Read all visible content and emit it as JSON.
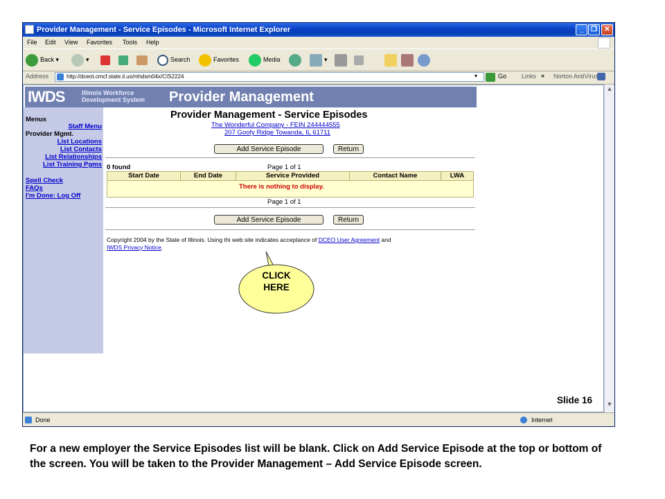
{
  "window": {
    "title": "Provider Management - Service Episodes - Microsoft Internet Explorer",
    "controls": [
      "_",
      "❐",
      "✕"
    ]
  },
  "menubar": [
    "File",
    "Edit",
    "View",
    "Favorites",
    "Tools",
    "Help"
  ],
  "toolbar": {
    "back": "Back",
    "search": "Search",
    "favorites": "Favorites",
    "media": "Media"
  },
  "address": {
    "label": "Address",
    "url": "http://dceot.cmcf.state.il.us/mhdsm04x/CIS2224",
    "go": "Go",
    "links": "Links",
    "chevron": "»",
    "norton": "Norton AntiVirus"
  },
  "header": {
    "logo": "IWDS",
    "sub_line1": "Illinois Workforce",
    "sub_line2": "Development System",
    "banner": "Provider Management"
  },
  "sidebar": {
    "menus": "Menus",
    "staff_menu": "Staff Menu",
    "provider_mgmt": "Provider Mgmt.",
    "items": [
      "List Locations",
      "List Contacts",
      "List Relationships",
      "List Training Pgms"
    ],
    "spell_check": "Spell Check",
    "faqs": "FAQs",
    "logoff": "I'm Done: Log Off"
  },
  "main": {
    "title": "Provider Management - Service Episodes",
    "company": "The Wonderful Company - FEIN 244444555",
    "address": "207 Goofy Ridge Towanda, IL 61711",
    "add_button": "Add Service Episode",
    "return_button": "Return",
    "found": "0  found",
    "page_info": "Page 1 of 1",
    "columns": [
      "Start Date",
      "End Date",
      "Service Provided",
      "Contact Name",
      "LWA"
    ],
    "empty_message": "There is nothing to display.",
    "copyright_prefix": "Copyright 2004 by the State of Illinois. Using thi",
    "copyright_mid": " web site indicates acceptance of ",
    "user_agreement": "DCEO User Agreement",
    "and": " and",
    "privacy": "IWDS Privacy Notice",
    "period": "."
  },
  "callout": {
    "line1": "CLICK",
    "line2": "HERE"
  },
  "slide_number": "Slide 16",
  "status": {
    "left": "Done",
    "zone": "Internet"
  },
  "caption": "For a  new employer the Service Episodes list will be blank.  Click on Add Service Episode at the top or bottom of the screen.  You will be taken to the Provider Management – Add Service Episode screen.",
  "colors": {
    "title_blue": "#0a3fc4",
    "header_bg": "#7080b0",
    "sidebar_bg": "#c5cae6",
    "grid_bg": "#ffffd0",
    "error_red": "#cc0000",
    "callout_fill": "#ffff99"
  }
}
